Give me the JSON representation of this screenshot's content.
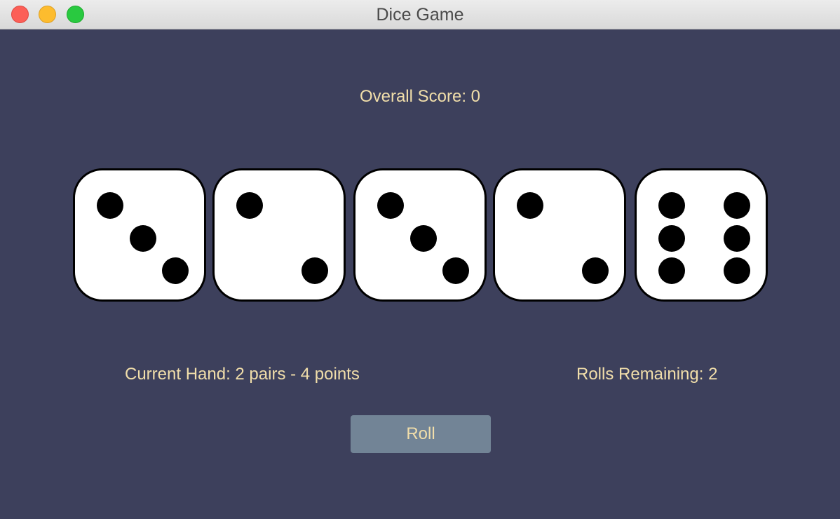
{
  "window": {
    "title": "Dice Game"
  },
  "game": {
    "overall_score_text": "Overall Score: 0",
    "dice": [
      3,
      2,
      3,
      2,
      6
    ],
    "current_hand_text": "Current Hand: 2 pairs - 4 points",
    "rolls_remaining_text": "Rolls Remaining: 2",
    "roll_button_label": "Roll"
  },
  "colors": {
    "background": "#3d405c",
    "text": "#f1deaa",
    "button": "#728496",
    "die_face": "#ffffff",
    "pip": "#000000"
  }
}
